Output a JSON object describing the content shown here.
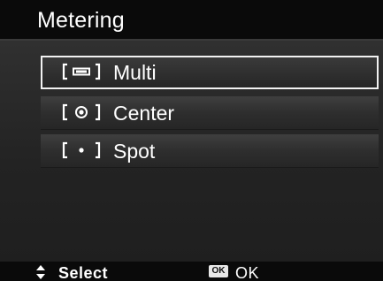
{
  "header": {
    "title": "Metering"
  },
  "menu": {
    "items": [
      {
        "label": "Multi",
        "icon": "multi-metering-icon",
        "selected": true
      },
      {
        "label": "Center",
        "icon": "center-metering-icon",
        "selected": false
      },
      {
        "label": "Spot",
        "icon": "spot-metering-icon",
        "selected": false
      }
    ]
  },
  "footer": {
    "select_icon": "up-down-arrows-icon",
    "select_label": "Select",
    "ok_badge": "OK",
    "ok_label": "OK"
  },
  "colors": {
    "title_bar": "#0a0a0a",
    "background": "#262626",
    "selection_border": "#f2f2f2",
    "text": "#ffffff"
  }
}
